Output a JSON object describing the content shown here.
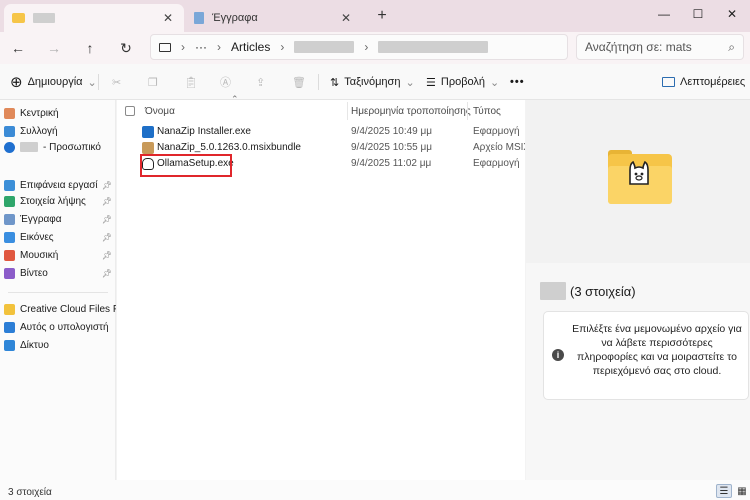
{
  "tabs": [
    {
      "title": "",
      "active": true
    },
    {
      "title": "Έγγραφα",
      "active": false
    }
  ],
  "address": {
    "path_visible": "Articles",
    "more": "···"
  },
  "search": {
    "placeholder": "Αναζήτηση σε: mats"
  },
  "commands": {
    "new": "Δημιουργία",
    "sort": "Ταξινόμηση",
    "view": "Προβολή",
    "more": "•••",
    "details": "Λεπτομέρειες"
  },
  "sidebar": {
    "items": [
      {
        "label": "Κεντρική",
        "icon": "home-icon"
      },
      {
        "label": "Συλλογή",
        "icon": "gallery-icon"
      },
      {
        "label": "- Προσωπικό",
        "icon": "onedrive-icon"
      },
      {
        "label": "Επιφάνεια εργασί",
        "icon": "desktop-icon",
        "pinned": true
      },
      {
        "label": "Στοιχεία λήψης",
        "icon": "downloads-icon",
        "pinned": true
      },
      {
        "label": "Έγγραφα",
        "icon": "documents-icon",
        "pinned": true
      },
      {
        "label": "Εικόνες",
        "icon": "pictures-icon",
        "pinned": true
      },
      {
        "label": "Μουσική",
        "icon": "music-icon",
        "pinned": true
      },
      {
        "label": "Βίντεο",
        "icon": "videos-icon",
        "pinned": true
      },
      {
        "label": "Creative Cloud Files F",
        "icon": "creative-cloud-icon"
      },
      {
        "label": "Αυτός ο υπολογιστή",
        "icon": "this-pc-icon"
      },
      {
        "label": "Δίκτυο",
        "icon": "network-icon"
      }
    ]
  },
  "columns": {
    "name": "Όνομα",
    "modified": "Ημερομηνία τροποποίησης",
    "type": "Τύπος"
  },
  "files": [
    {
      "name": "NanaZip Installer.exe",
      "modified": "9/4/2025 10:49 μμ",
      "type": "Εφαρμογή",
      "icon": "installer-icon"
    },
    {
      "name": "NanaZip_5.0.1263.0.msixbundle",
      "modified": "9/4/2025 10:55 μμ",
      "type": "Αρχείο MSIX",
      "icon": "package-icon"
    },
    {
      "name": "OllamaSetup.exe",
      "modified": "9/4/2025 11:02 μμ",
      "type": "Εφαρμογή",
      "icon": "ollama-icon",
      "highlighted": true
    }
  ],
  "details_pane": {
    "count": "(3 στοιχεία)",
    "info": "Επιλέξτε ένα μεμονωμένο αρχείο για να λάβετε περισσότερες πληροφορίες και να μοιραστείτε το περιεχόμενό σας στο cloud."
  },
  "status": {
    "text": "3 στοιχεία"
  },
  "colors": {
    "accent": "#0067c0",
    "highlight": "#e0262b",
    "tabbar": "#ecdde4"
  }
}
